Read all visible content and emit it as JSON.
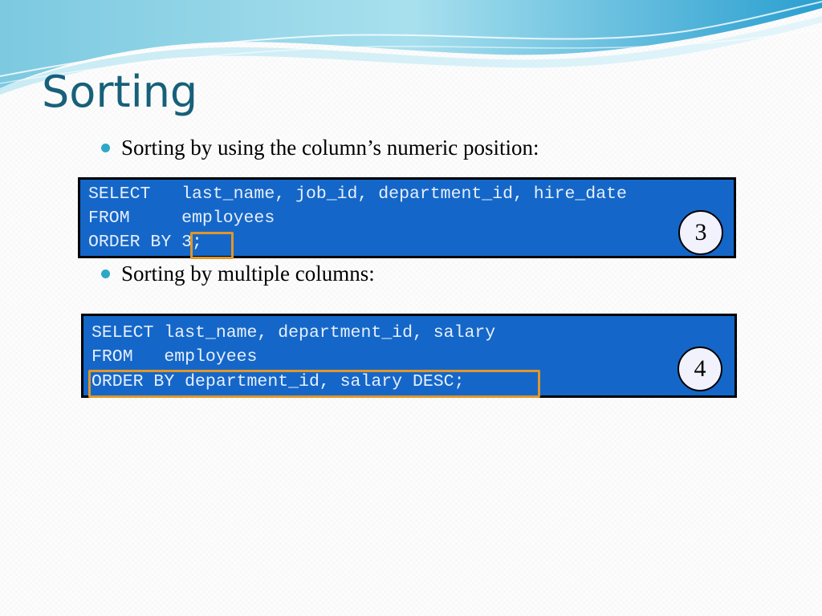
{
  "slide": {
    "title": "Sorting",
    "bullets": [
      "Sorting by using the column’s numeric position:",
      "Sorting by multiple columns:"
    ],
    "code_blocks": [
      {
        "lines": [
          "SELECT   last_name, job_id, department_id, hire_date",
          "FROM     employees",
          "ORDER BY 3;"
        ],
        "highlighted_text": "3;",
        "badge": "3"
      },
      {
        "lines": [
          "SELECT last_name, department_id, salary",
          "FROM   employees",
          "ORDER BY department_id, salary DESC;"
        ],
        "highlighted_text": "ORDER BY department_id, salary DESC;",
        "badge": "4"
      }
    ]
  },
  "colors": {
    "title": "#17607a",
    "bullet_marker": "#2ea7c8",
    "code_background": "#1467c8",
    "code_text": "#e8eefc",
    "highlight_border": "#e0962a",
    "badge_fill": "#f1f2fc"
  }
}
